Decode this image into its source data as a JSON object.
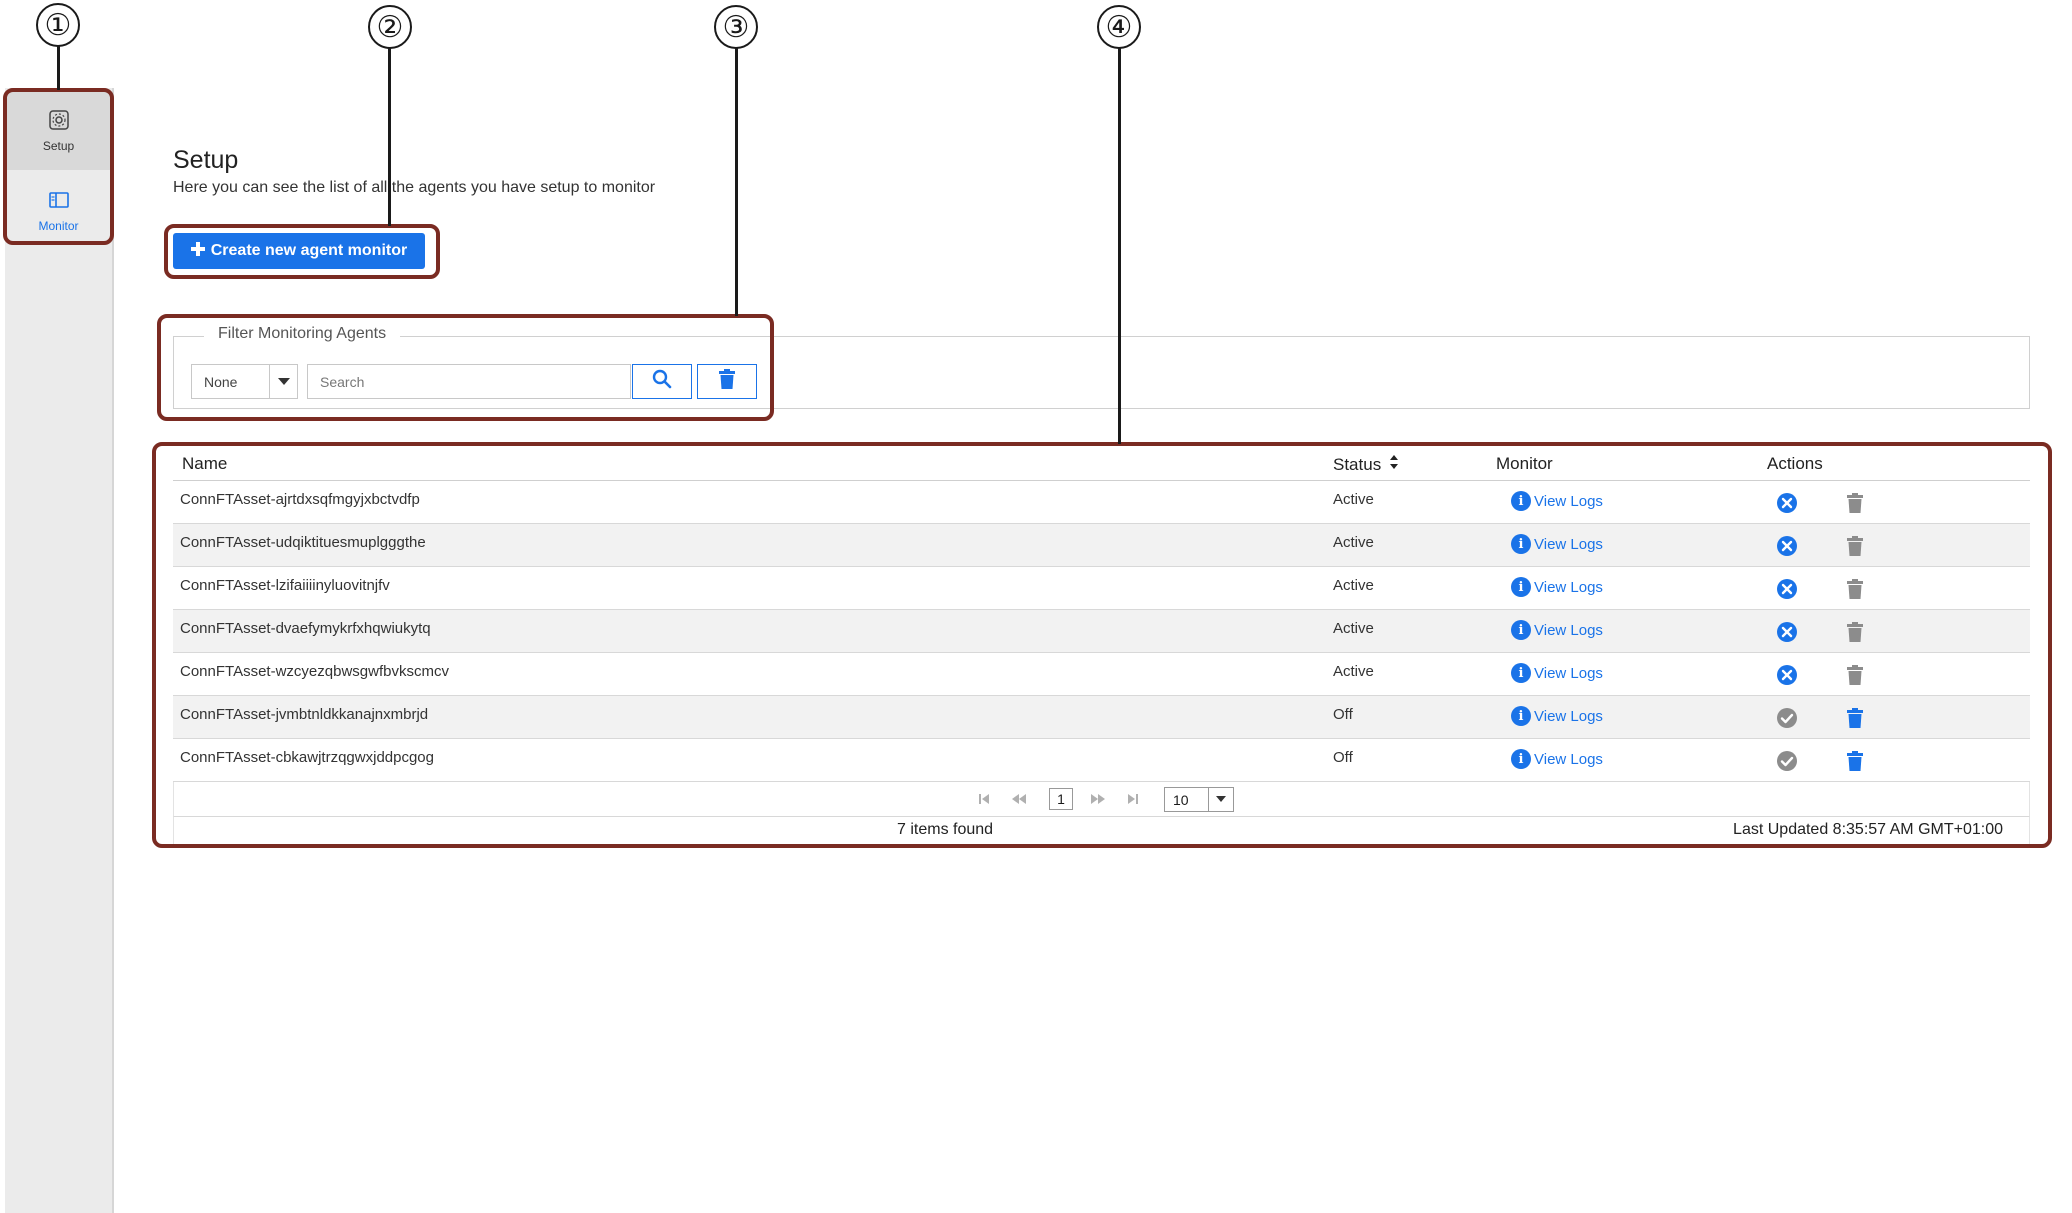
{
  "callouts": [
    "①",
    "②",
    "③",
    "④"
  ],
  "sidebar": {
    "items": [
      {
        "label": "Setup",
        "icon": "gear-icon"
      },
      {
        "label": "Monitor",
        "icon": "monitor-panel-icon"
      }
    ]
  },
  "header": {
    "title": "Setup",
    "description": "Here you can see the list of all the agents you have setup to monitor",
    "create_button": "Create new agent monitor"
  },
  "filter": {
    "legend": "Filter Monitoring Agents",
    "select_value": "None",
    "search_placeholder": "Search"
  },
  "table": {
    "columns": [
      "Name",
      "Status",
      "Monitor",
      "Actions"
    ],
    "rows": [
      {
        "name": "ConnFTAsset-ajrtdxsqfmgyjxbctvdfp",
        "status": "Active",
        "monitor": "View Logs"
      },
      {
        "name": "ConnFTAsset-udqiktituesmuplgggthe",
        "status": "Active",
        "monitor": "View Logs"
      },
      {
        "name": "ConnFTAsset-lzifaiiiinyluovitnjfv",
        "status": "Active",
        "monitor": "View Logs"
      },
      {
        "name": "ConnFTAsset-dvaefymykrfxhqwiukytq",
        "status": "Active",
        "monitor": "View Logs"
      },
      {
        "name": "ConnFTAsset-wzcyezqbwsgwfbvkscmcv",
        "status": "Active",
        "monitor": "View Logs"
      },
      {
        "name": "ConnFTAsset-jvmbtnldkkanajnxmbrjd",
        "status": "Off",
        "monitor": "View Logs"
      },
      {
        "name": "ConnFTAsset-cbkawjtrzqgwxjddpcgog",
        "status": "Off",
        "monitor": "View Logs"
      }
    ]
  },
  "pagination": {
    "current_page": "1",
    "page_size": "10"
  },
  "footer": {
    "items_found": "7 items found",
    "last_updated": "Last Updated 8:35:57 AM GMT+01:00"
  },
  "colors": {
    "accent": "#1a73e8",
    "callout_border": "#7a2b22",
    "sidebar_bg": "#ebebeb",
    "row_alt": "#f2f2f2",
    "deactivate_icon": "#1a73e8",
    "activate_icon_disabled": "#8c8c8c"
  }
}
